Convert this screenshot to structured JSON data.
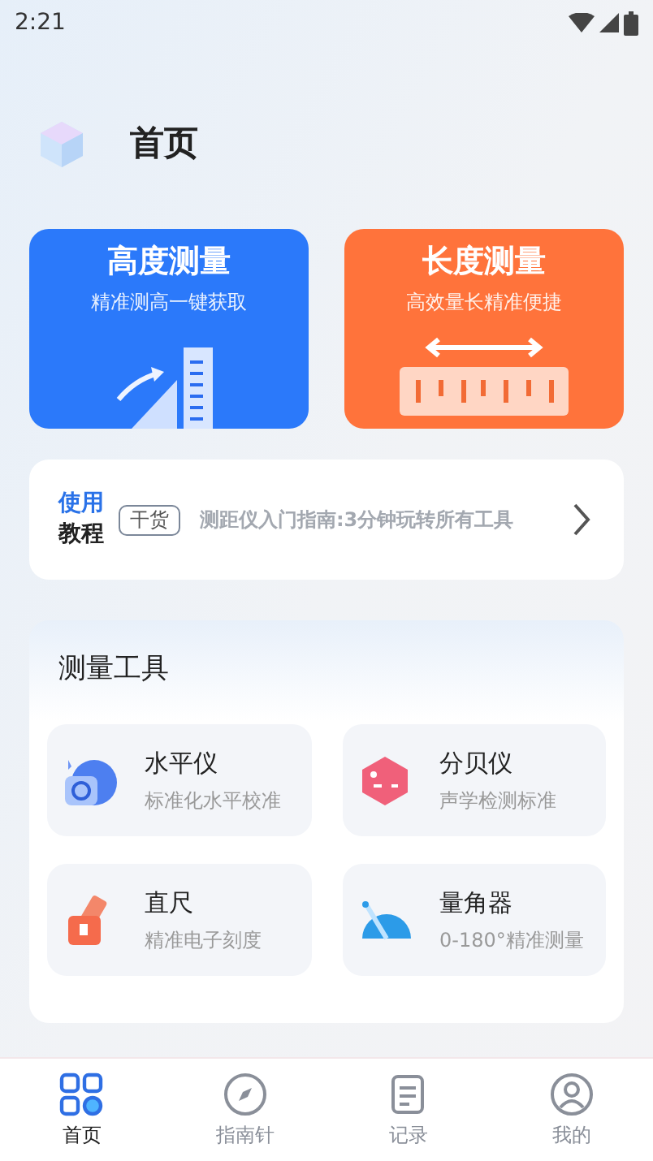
{
  "status_bar": {
    "time": "2:21"
  },
  "header": {
    "title": "首页"
  },
  "feature_cards": [
    {
      "kind": "height",
      "title": "高度测量",
      "subtitle": "精准测高一键获取"
    },
    {
      "kind": "length",
      "title": "长度测量",
      "subtitle": "高效量长精准便捷"
    }
  ],
  "tutorial": {
    "label_top": "使用",
    "label_bottom": "教程",
    "tag": "干货",
    "text": "测距仪入门指南:3分钟玩转所有工具"
  },
  "tools_section": {
    "title": "测量工具",
    "tools": [
      {
        "kind": "level",
        "name": "水平仪",
        "desc": "标准化水平校准"
      },
      {
        "kind": "decibel",
        "name": "分贝仪",
        "desc": "声学检测标准"
      },
      {
        "kind": "ruler",
        "name": "直尺",
        "desc": "精准电子刻度"
      },
      {
        "kind": "protractor",
        "name": "量角器",
        "desc": "0-180°精准测量"
      }
    ]
  },
  "bottom_nav": [
    {
      "kind": "home",
      "label": "首页",
      "selected": true
    },
    {
      "kind": "compass",
      "label": "指南针",
      "selected": false
    },
    {
      "kind": "record",
      "label": "记录",
      "selected": false
    },
    {
      "kind": "profile",
      "label": "我的",
      "selected": false
    }
  ]
}
